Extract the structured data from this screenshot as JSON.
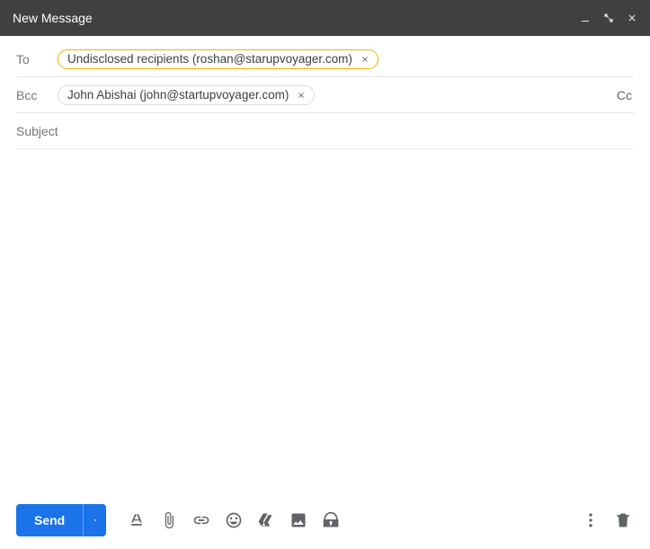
{
  "header": {
    "title": "New Message"
  },
  "recipients": {
    "to_label": "To",
    "to_chip": "Undisclosed recipients (roshan@starupvoyager.com)",
    "bcc_label": "Bcc",
    "bcc_chip": "John Abishai (john@startupvoyager.com)",
    "cc_toggle": "Cc"
  },
  "subject": {
    "placeholder": "Subject",
    "value": ""
  },
  "body": {
    "text": ""
  },
  "toolbar": {
    "send_label": "Send"
  }
}
